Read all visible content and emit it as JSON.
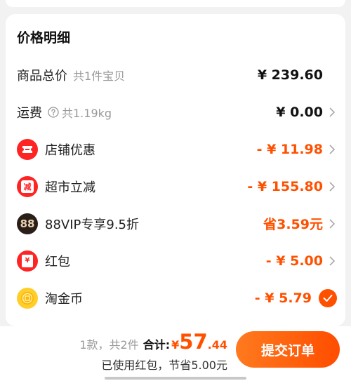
{
  "card": {
    "title": "价格明细",
    "rows": [
      {
        "label": "商品总价",
        "sub": "共1件宝贝",
        "amount": "¥ 239.60"
      },
      {
        "label": "运费",
        "sub": "共1.19kg",
        "amount": "¥ 0.00"
      },
      {
        "label": "店铺优惠",
        "amount": "- ¥ 11.98"
      },
      {
        "label": "超市立减",
        "amount": "- ¥ 155.80"
      },
      {
        "label": "88VIP专享9.5折",
        "amount": "省3.59元"
      },
      {
        "label": "红包",
        "amount": "- ¥ 5.00"
      },
      {
        "label": "淘金币",
        "amount": "- ¥ 5.79"
      }
    ]
  },
  "icons": {
    "question": "question-circle-icon",
    "shop": "ticket-icon",
    "supermarket": "discount-badge-icon",
    "vip": "88vip-badge-icon",
    "vip_text": "88",
    "hongbao": "red-envelope-icon",
    "hongbao_char": "¥",
    "supermarket_char": "减",
    "coin": "gold-coin-icon",
    "check": "checkmark-icon",
    "chevron": "chevron-right-icon"
  },
  "colors": {
    "accent": "#ff5000",
    "red": "#ff2424",
    "gold": "#ffce2a",
    "dark": "#2a1e18"
  },
  "footer": {
    "count": "1款，共2件",
    "total_label": "合计:",
    "currency": "¥",
    "total_int": "57",
    "total_dec": ".44",
    "note": "已使用红包，节省5.00元",
    "submit": "提交订单"
  }
}
